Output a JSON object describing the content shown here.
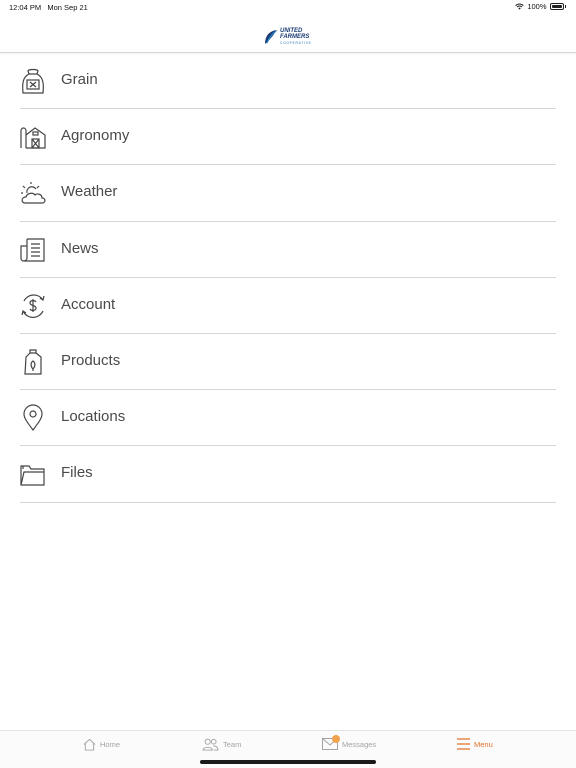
{
  "status": {
    "time": "12:04 PM",
    "date": "Mon Sep 21",
    "battery": "100%"
  },
  "logo": {
    "line1": "UNITED",
    "line2": "FARMERS",
    "line3": "COOPERATIVE"
  },
  "menu": {
    "items": [
      {
        "label": "Grain",
        "icon": "grain-sack-icon"
      },
      {
        "label": "Agronomy",
        "icon": "barn-icon"
      },
      {
        "label": "Weather",
        "icon": "sun-cloud-icon"
      },
      {
        "label": "News",
        "icon": "newspaper-icon"
      },
      {
        "label": "Account",
        "icon": "dollar-circle-icon"
      },
      {
        "label": "Products",
        "icon": "jug-icon"
      },
      {
        "label": "Locations",
        "icon": "map-pin-icon"
      },
      {
        "label": "Files",
        "icon": "folder-icon"
      }
    ]
  },
  "tabs": {
    "home": "Home",
    "team": "Team",
    "messages": "Messages",
    "menu": "Menu"
  },
  "colors": {
    "accent": "#e1702a",
    "brand": "#1b3b73",
    "badge": "#f0a24d"
  }
}
